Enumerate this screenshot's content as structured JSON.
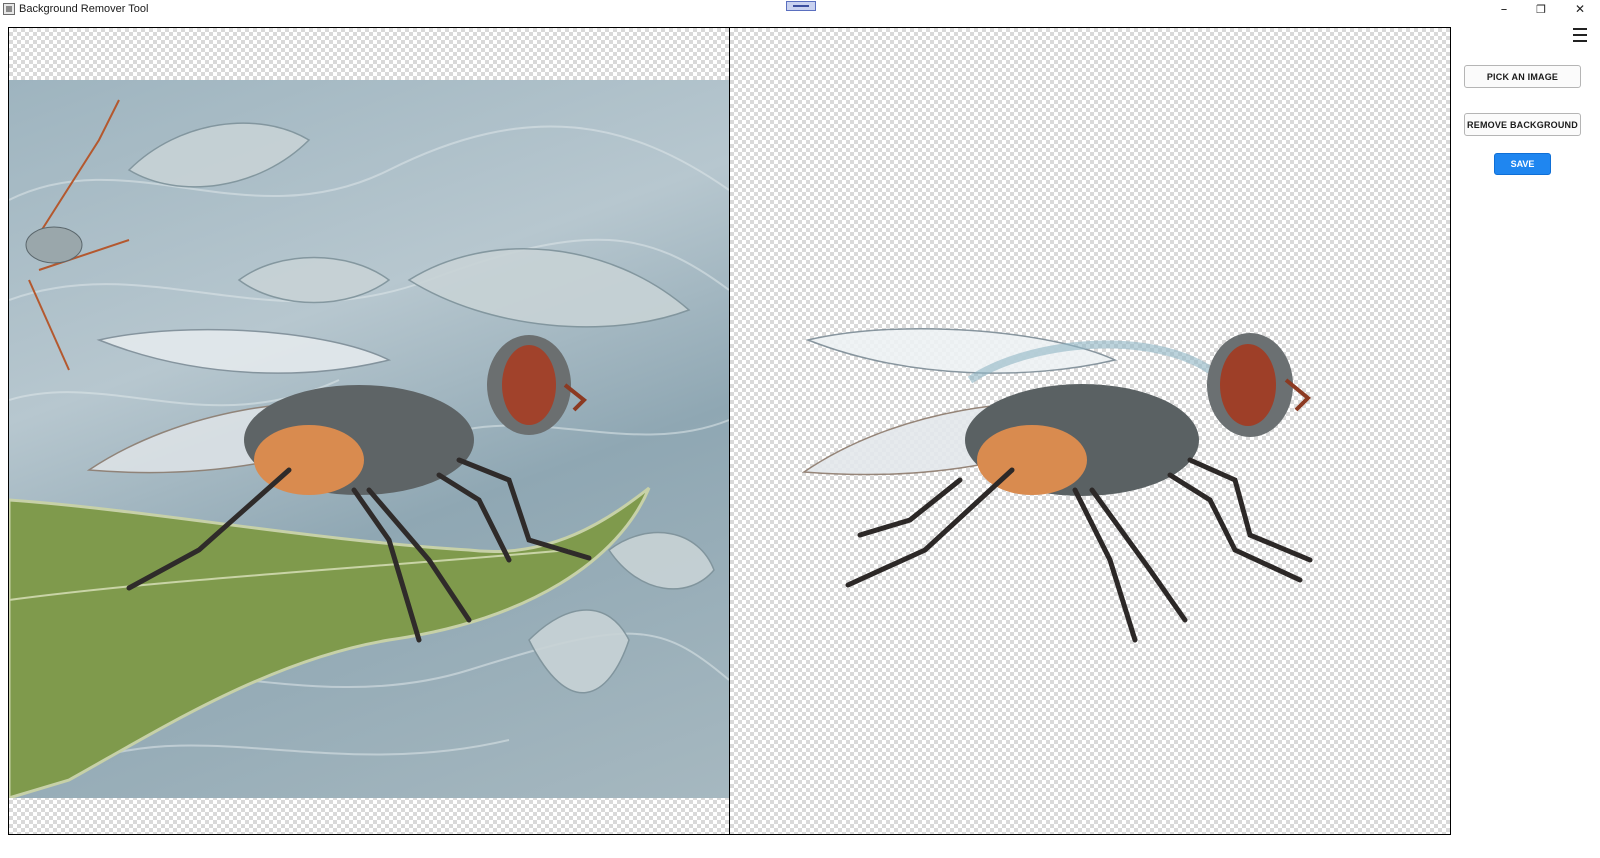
{
  "window": {
    "title": "Background Remover Tool",
    "controls": {
      "minimize": "–",
      "maximize": "❐",
      "close": "✕"
    }
  },
  "sidebar": {
    "menu_icon": "hamburger-menu-icon",
    "pick_image_label": "PICK AN IMAGE",
    "remove_background_label": "REMOVE BACKGROUND",
    "save_label": "SAVE"
  },
  "colors": {
    "accent": "#1f86f0",
    "checker_light": "#ffffff",
    "checker_dark": "#d9d9d9"
  }
}
